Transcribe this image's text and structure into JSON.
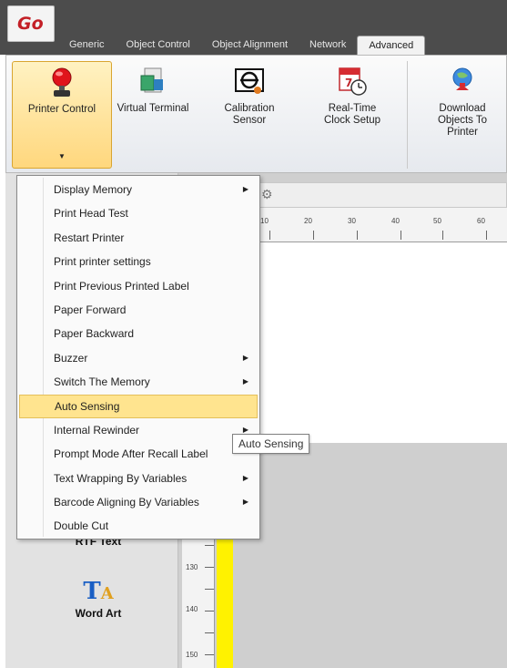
{
  "app": {
    "logo_text": "Go",
    "brand_color": "#c31f26"
  },
  "tabs": [
    {
      "label": "Generic"
    },
    {
      "label": "Object Control"
    },
    {
      "label": "Object Alignment"
    },
    {
      "label": "Network"
    },
    {
      "label": "Advanced",
      "active": true
    }
  ],
  "ribbon": {
    "printer_control": "Printer Control",
    "virtual_terminal": "Virtual Terminal",
    "calibration_sensor_1": "Calibration",
    "calibration_sensor_2": "Sensor",
    "rtc_setup_1": "Real-Time",
    "rtc_setup_2": "Clock Setup",
    "download_objects_1": "Download",
    "download_objects_2": "Objects To",
    "download_objects_3": "Printer"
  },
  "context_menu": {
    "items": [
      {
        "label": "Display Memory",
        "submenu": true
      },
      {
        "label": "Print Head Test",
        "submenu": false
      },
      {
        "label": "Restart Printer",
        "submenu": false
      },
      {
        "label": "Print printer settings",
        "submenu": false
      },
      {
        "label": "Print Previous Printed Label",
        "submenu": false
      },
      {
        "label": "Paper Forward",
        "submenu": false
      },
      {
        "label": "Paper Backward",
        "submenu": false
      },
      {
        "label": "Buzzer",
        "submenu": true
      },
      {
        "label": "Switch The Memory",
        "submenu": true
      },
      {
        "label": "Auto Sensing",
        "submenu": false,
        "highlighted": true
      },
      {
        "label": "Internal Rewinder",
        "submenu": true
      },
      {
        "label": "Prompt Mode After Recall Label",
        "submenu": false
      },
      {
        "label": "Text Wrapping By Variables",
        "submenu": true
      },
      {
        "label": "Barcode Aligning By Variables",
        "submenu": true
      },
      {
        "label": "Double Cut",
        "submenu": false
      }
    ]
  },
  "tooltip": {
    "text": "Auto Sensing"
  },
  "ruler": {
    "h_labels": [
      "10",
      "20",
      "30",
      "40",
      "50",
      "60"
    ],
    "v_labels": [
      "130",
      "140",
      "150"
    ]
  },
  "left_panel": {
    "rtf_text": "RTF Text",
    "word_art": "Word Art"
  }
}
